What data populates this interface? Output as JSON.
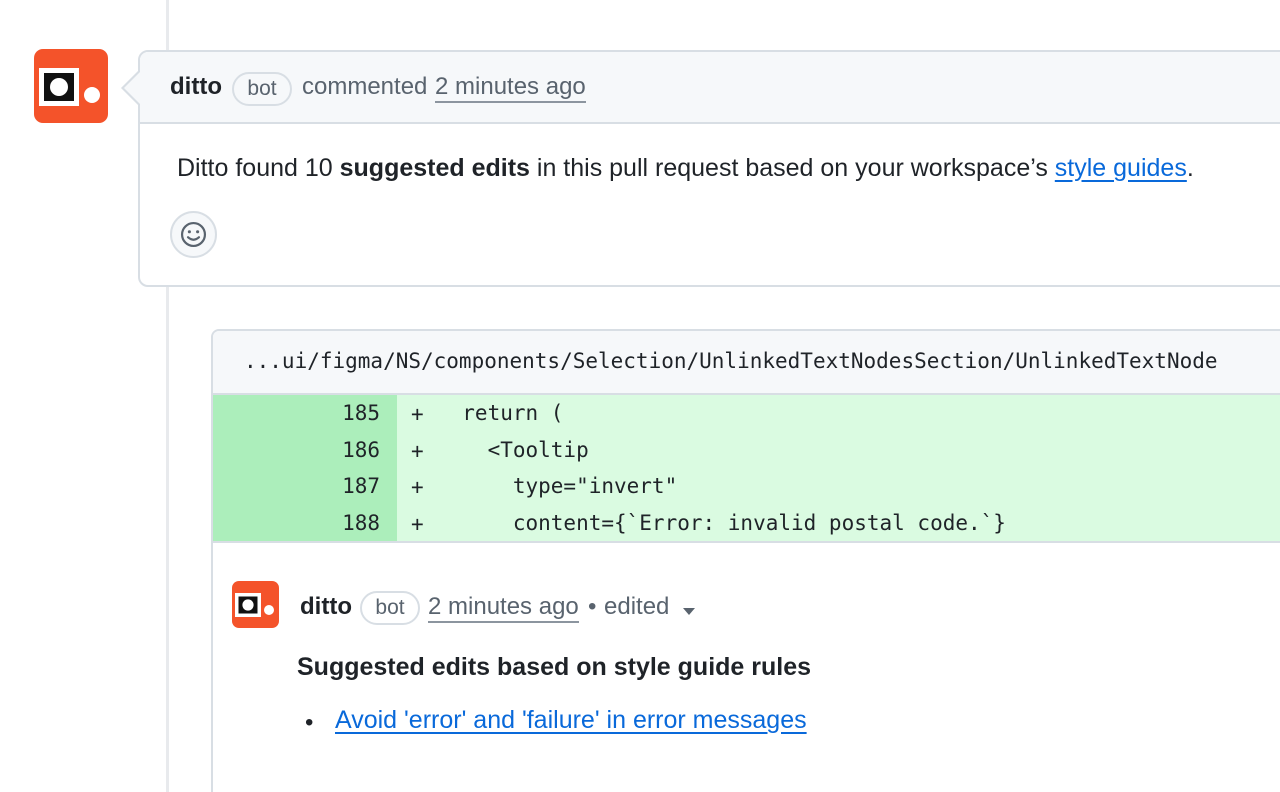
{
  "comment": {
    "author": "ditto",
    "badge": "bot",
    "action": "commented",
    "timestamp": "2 minutes ago",
    "body_prefix": "Ditto found 10 ",
    "body_bold": "suggested edits",
    "body_middle": " in this pull request based on your workspace’s ",
    "body_link": "style guides",
    "body_suffix": ".",
    "reaction_icon": "smiley-icon"
  },
  "review": {
    "file_path": "...ui/figma/NS/components/Selection/UnlinkedTextNodesSection/UnlinkedTextNode",
    "diff": [
      {
        "line": "185",
        "sign": "+",
        "code": "  return ("
      },
      {
        "line": "186",
        "sign": "+",
        "code": "    <Tooltip"
      },
      {
        "line": "187",
        "sign": "+",
        "code": "      type=\"invert\""
      },
      {
        "line": "188",
        "sign": "+",
        "code": "      content={`Error: invalid postal code.`}"
      }
    ],
    "colors": {
      "added_row": "#dafbe1",
      "added_gutter": "#aceebb"
    }
  },
  "reply": {
    "author": "ditto",
    "badge": "bot",
    "timestamp": "2 minutes ago",
    "separator": "•",
    "edited": "edited",
    "heading": "Suggested edits based on style guide rules",
    "bullet": "•",
    "rule_link": "Avoid 'error' and 'failure' in error messages"
  },
  "colors": {
    "brand": "#f4532a",
    "link": "#0969da",
    "border": "#d8dee4",
    "muted": "#59636e"
  }
}
